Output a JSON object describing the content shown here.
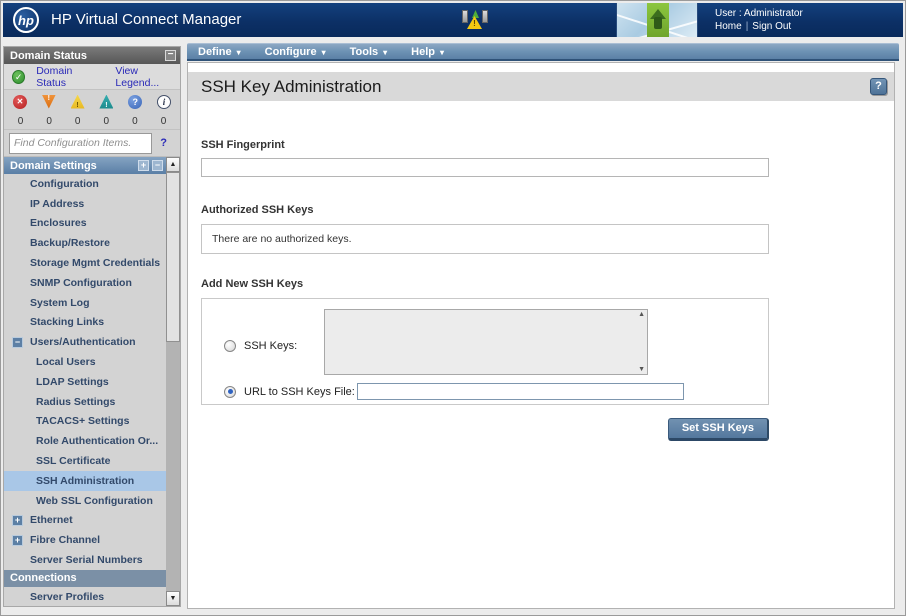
{
  "header": {
    "logo_text": "hp",
    "title": "HP Virtual Connect Manager",
    "user_prefix": "User :",
    "user_name": "Administrator",
    "home_link": "Home",
    "link_separator": "|",
    "signout_link": "Sign Out"
  },
  "menubar": {
    "items": [
      {
        "label": "Define"
      },
      {
        "label": "Configure"
      },
      {
        "label": "Tools"
      },
      {
        "label": "Help"
      }
    ]
  },
  "sidebar": {
    "domain_status": {
      "title": "Domain Status",
      "status_link": "Domain Status",
      "legend_link": "View Legend...",
      "counters": [
        {
          "type": "critical",
          "count": "0"
        },
        {
          "type": "major",
          "count": "0"
        },
        {
          "type": "minor",
          "count": "0"
        },
        {
          "type": "warning",
          "count": "0"
        },
        {
          "type": "unknown",
          "count": "0"
        },
        {
          "type": "info",
          "count": "0"
        }
      ],
      "find_placeholder": "Find Configuration Items.",
      "find_help": "?"
    },
    "domain_settings": {
      "title": "Domain Settings",
      "tree": [
        {
          "label": "Configuration",
          "indent": 1
        },
        {
          "label": "IP Address",
          "indent": 1
        },
        {
          "label": "Enclosures",
          "indent": 1
        },
        {
          "label": "Backup/Restore",
          "indent": 1
        },
        {
          "label": "Storage Mgmt Credentials",
          "indent": 1
        },
        {
          "label": "SNMP Configuration",
          "indent": 1
        },
        {
          "label": "System Log",
          "indent": 1
        },
        {
          "label": "Stacking Links",
          "indent": 1
        },
        {
          "label": "Users/Authentication",
          "indent": 0,
          "toggle": "minus"
        },
        {
          "label": "Local Users",
          "indent": 2
        },
        {
          "label": "LDAP Settings",
          "indent": 2
        },
        {
          "label": "Radius Settings",
          "indent": 2
        },
        {
          "label": "TACACS+ Settings",
          "indent": 2
        },
        {
          "label": "Role Authentication Or...",
          "indent": 2
        },
        {
          "label": "SSL Certificate",
          "indent": 2
        },
        {
          "label": "SSH Administration",
          "indent": 2,
          "selected": true
        },
        {
          "label": "Web SSL Configuration",
          "indent": 2
        },
        {
          "label": "Ethernet",
          "indent": 0,
          "toggle": "plus"
        },
        {
          "label": "Fibre Channel",
          "indent": 0,
          "toggle": "plus"
        },
        {
          "label": "Server Serial Numbers",
          "indent": 1
        }
      ]
    },
    "connections": {
      "title": "Connections",
      "items": [
        {
          "label": "Server Profiles",
          "indent": 1
        }
      ]
    }
  },
  "main": {
    "page_title": "SSH Key Administration",
    "help_button": "?",
    "fingerprint": {
      "label": "SSH Fingerprint",
      "value": ""
    },
    "authorized": {
      "label": "Authorized SSH Keys",
      "empty_text": "There are no authorized keys."
    },
    "add_new": {
      "label": "Add New SSH Keys",
      "ssh_keys_option": {
        "label": "SSH Keys:",
        "selected": false,
        "value": ""
      },
      "url_option": {
        "label": "URL to SSH Keys File:",
        "selected": true,
        "value": ""
      }
    },
    "set_button": "Set SSH Keys"
  },
  "icons": {
    "caret": "▾",
    "collapse": "−",
    "expand": "+",
    "check": "✓",
    "cross": "✕",
    "bang": "!",
    "question": "?",
    "info": "i",
    "scroll_up": "▲",
    "scroll_down": "▼"
  },
  "colors": {
    "header_bg": "#0c3066",
    "menubar_bg": "#6d92b4",
    "accent": "#5d80a5",
    "selected_item_bg": "#a9c7e7",
    "link": "#2a2ab8",
    "tree_text": "#32496a",
    "title_band_bg": "#d9d9d9",
    "warning_yellow": "#f2c811",
    "ok_green": "#2f8f2f"
  }
}
